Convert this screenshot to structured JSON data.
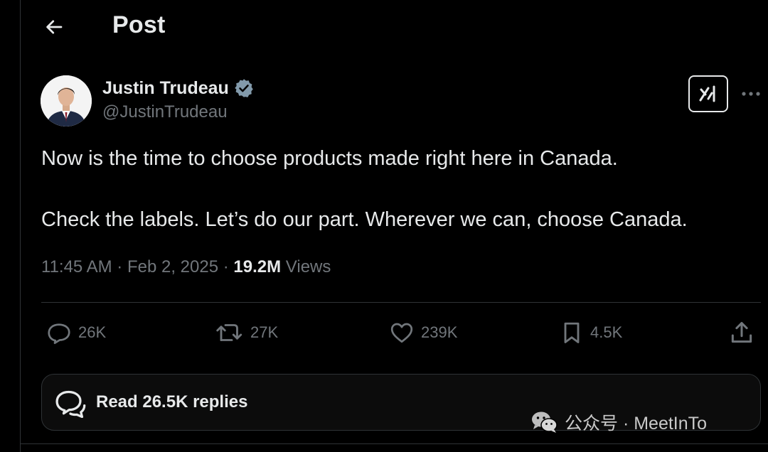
{
  "header": {
    "title": "Post"
  },
  "author": {
    "name": "Justin Trudeau",
    "handle": "@JustinTrudeau"
  },
  "post": {
    "line1": "Now is the time to choose products made right here in Canada.",
    "line2": "Check the labels. Let’s do our part. Wherever we can, choose Canada.",
    "time": "11:45 AM",
    "date": "Feb 2, 2025",
    "views_count": "19.2M",
    "views_label": "Views"
  },
  "actions": {
    "replies": "26K",
    "reposts": "27K",
    "likes": "239K",
    "bookmarks": "4.5K"
  },
  "replies_bar": {
    "label": "Read 26.5K replies"
  },
  "watermark": {
    "text": "公众号 · MeetInTo"
  },
  "colors": {
    "background": "#000000",
    "text": "#e7e9ea",
    "muted": "#71767b",
    "verified": "#829aab"
  }
}
